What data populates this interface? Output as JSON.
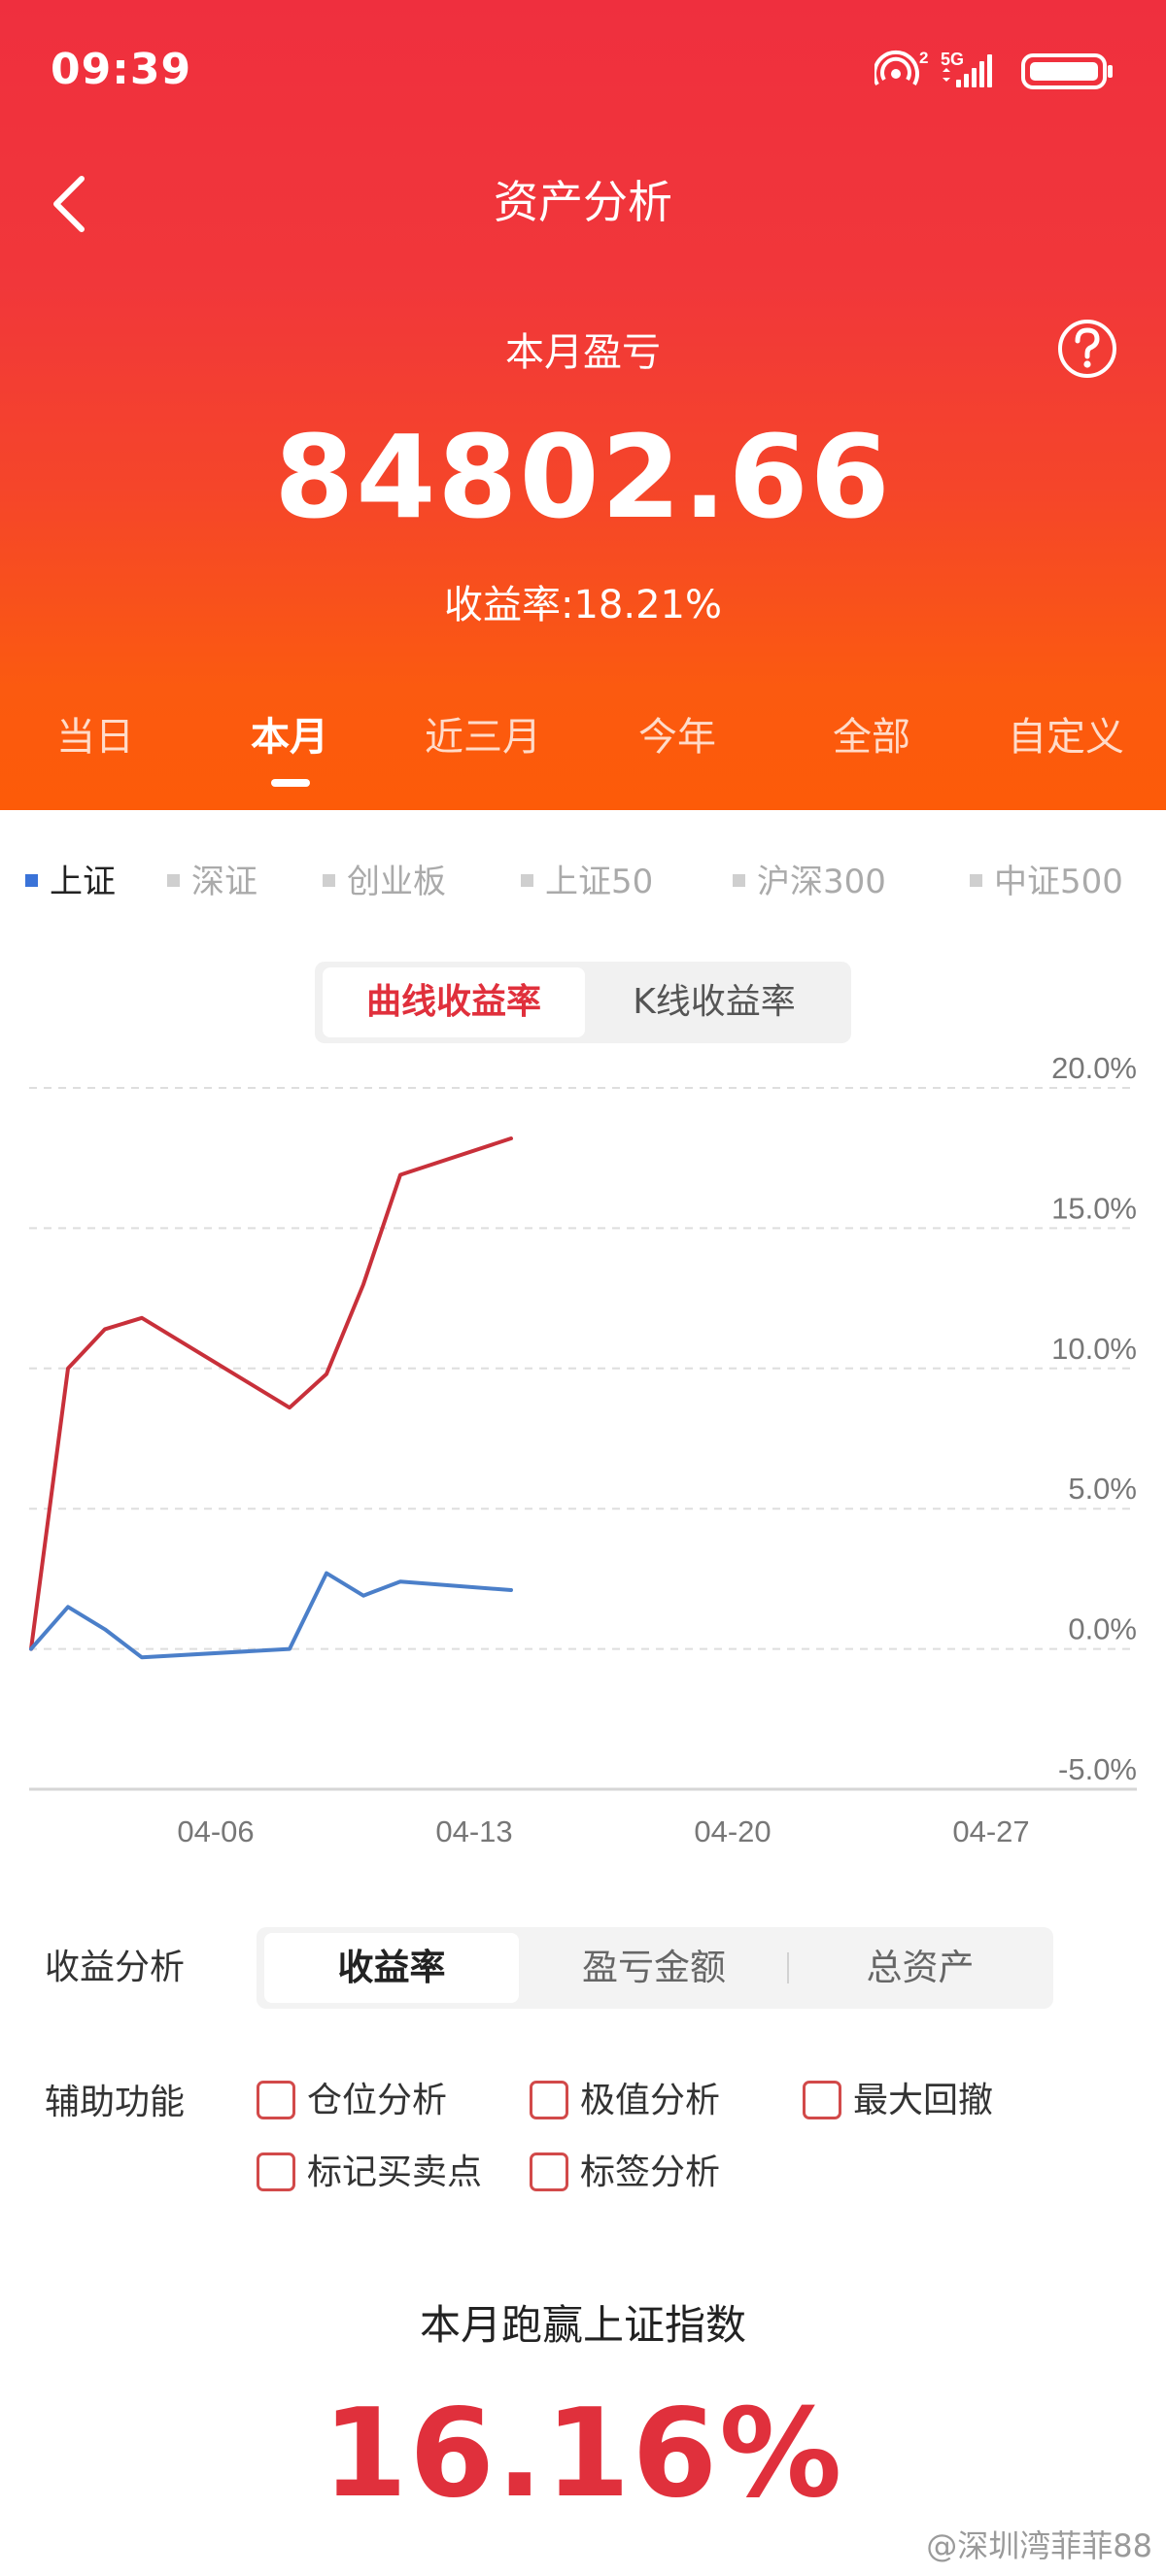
{
  "status_bar": {
    "time": "09:39",
    "network": "5G",
    "sim_badge": "2"
  },
  "nav": {
    "title": "资产分析",
    "back_icon": "chevron-left-icon",
    "help_icon": "question-circle-icon"
  },
  "summary": {
    "label": "本月盈亏",
    "value": "84802.66",
    "rate_text": "收益率:18.21%"
  },
  "period_tabs": {
    "items": [
      "当日",
      "本月",
      "近三月",
      "今年",
      "全部",
      "自定义"
    ],
    "active_index": 1
  },
  "index_legend": {
    "items": [
      "上证",
      "深证",
      "创业板",
      "上证50",
      "沪深300",
      "中证500"
    ],
    "active_index": 0
  },
  "chart_toggle": {
    "options": [
      "曲线收益率",
      "K线收益率"
    ],
    "active_index": 0
  },
  "chart_data": {
    "type": "line",
    "y_unit": "%",
    "ylim": [
      -5,
      20
    ],
    "yticks": [
      "20.0%",
      "15.0%",
      "10.0%",
      "5.0%",
      "0.0%",
      "-5.0%"
    ],
    "xticks": [
      "04-06",
      "04-13",
      "04-20",
      "04-27"
    ],
    "x_start": "04-01",
    "x_end": "04-30",
    "grid": true,
    "series": [
      {
        "color": "#c8303a",
        "points": [
          [
            "04-01",
            0.0
          ],
          [
            "04-02",
            10.0
          ],
          [
            "04-03",
            11.4
          ],
          [
            "04-04",
            11.8
          ],
          [
            "04-08",
            8.6
          ],
          [
            "04-09",
            9.8
          ],
          [
            "04-10",
            13.0
          ],
          [
            "04-11",
            16.9
          ],
          [
            "04-14",
            18.2
          ]
        ]
      },
      {
        "color": "#4b7fc9",
        "points": [
          [
            "04-01",
            0.0
          ],
          [
            "04-02",
            1.5
          ],
          [
            "04-03",
            0.7
          ],
          [
            "04-04",
            -0.3
          ],
          [
            "04-08",
            0.0
          ],
          [
            "04-09",
            2.7
          ],
          [
            "04-10",
            1.9
          ],
          [
            "04-11",
            2.4
          ],
          [
            "04-14",
            2.1
          ]
        ]
      }
    ]
  },
  "analysis": {
    "label": "收益分析",
    "options": [
      "收益率",
      "盈亏金额",
      "总资产"
    ],
    "active_index": 0
  },
  "aux": {
    "label": "辅助功能",
    "checks": [
      "仓位分析",
      "极值分析",
      "最大回撤",
      "标记买卖点",
      "标签分析"
    ]
  },
  "beat": {
    "title": "本月跑赢上证指数",
    "value": "16.16%"
  },
  "watermark": "@深圳湾菲菲88",
  "colors": {
    "header_top": "#ef2f3e",
    "header_bottom": "#fd5b08",
    "accent_red": "#e0303c",
    "index_blue": "#3a73d8"
  }
}
